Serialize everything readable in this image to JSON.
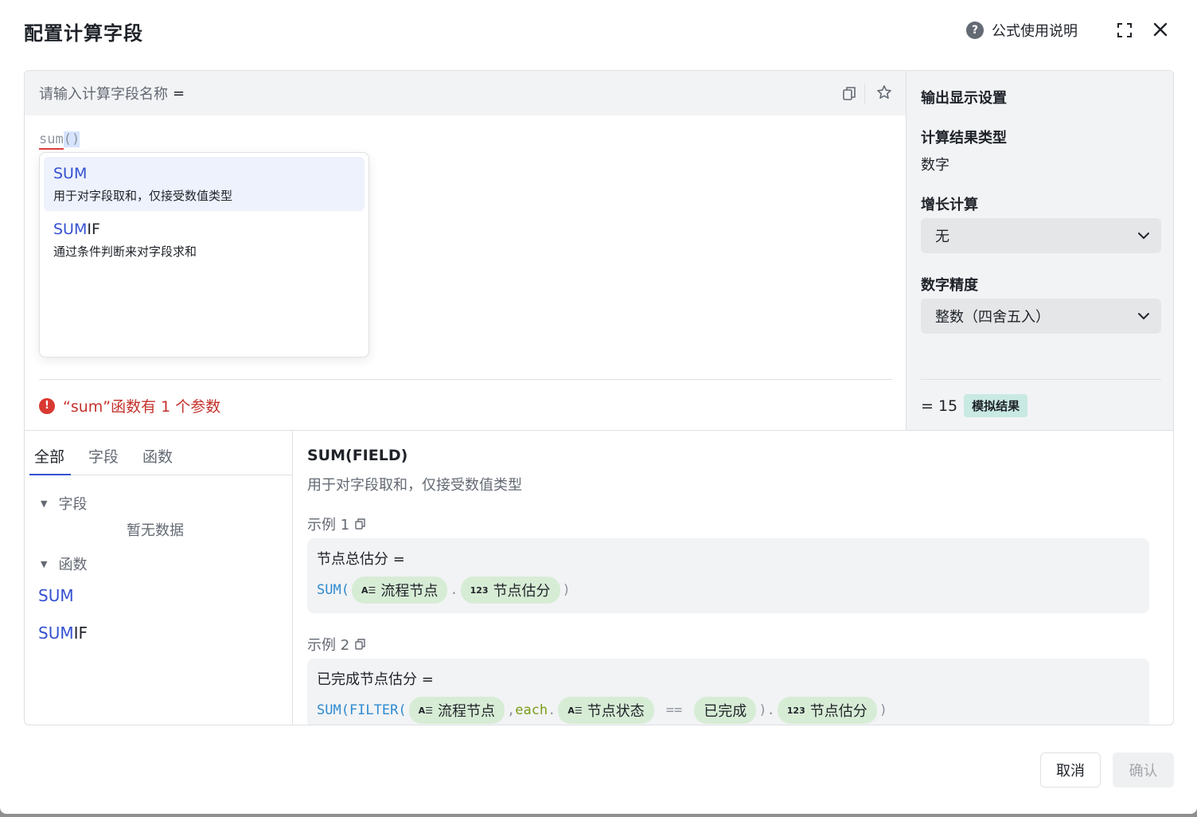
{
  "header": {
    "title": "配置计算字段",
    "help_label": "公式使用说明",
    "help_icon_glyph": "?"
  },
  "editor": {
    "name_placeholder": "请输入计算字段名称",
    "name_eq": "=",
    "formula_fn": "sum",
    "formula_parens": "()",
    "suggestions": [
      {
        "match": "SUM",
        "rest": "",
        "desc": "用于对字段取和，仅接受数值类型"
      },
      {
        "match": "SUM",
        "rest": "IF",
        "desc": "通过条件判断来对字段求和"
      }
    ],
    "error_icon_glyph": "!",
    "error": "“sum”函数有 1 个参数"
  },
  "output": {
    "title": "输出显示设置",
    "result_type_label": "计算结果类型",
    "result_type_value": "数字",
    "growth_label": "增长计算",
    "growth_value": "无",
    "precision_label": "数字精度",
    "precision_value": "整数（四舍五入）",
    "result_value": "= 15",
    "result_badge": "模拟结果"
  },
  "library": {
    "tabs": [
      "全部",
      "字段",
      "函数"
    ],
    "fields_section": "字段",
    "fields_empty": "暂无数据",
    "functions_section": "函数",
    "caret_glyph": "▼",
    "functions": [
      {
        "match": "SUM",
        "rest": ""
      },
      {
        "match": "SUM",
        "rest": "IF"
      }
    ]
  },
  "doc": {
    "title": "SUM(FIELD)",
    "desc": "用于对字段取和，仅接受数值类型",
    "example1": {
      "label": "示例 1",
      "head": "节点总估分 =",
      "fn": "SUM(",
      "chip1_icon": "A☰",
      "chip1": "流程节点",
      "dot": ".",
      "chip2_icon": "123",
      "chip2": "节点估分",
      "close": ")"
    },
    "example2": {
      "label": "示例 2",
      "head": "已完成节点估分 =",
      "fn": "SUM(FILTER(",
      "chip1_icon": "A☰",
      "chip1": "流程节点",
      "comma": ",",
      "each": "each",
      "dot": ".",
      "chip2_icon": "A☰",
      "chip2": "节点状态",
      "op": "==",
      "chip3": "已完成",
      "close1": ").",
      "chip4_icon": "123",
      "chip4": "节点估分",
      "close2": ")"
    }
  },
  "footer": {
    "cancel": "取消",
    "confirm": "确认"
  }
}
